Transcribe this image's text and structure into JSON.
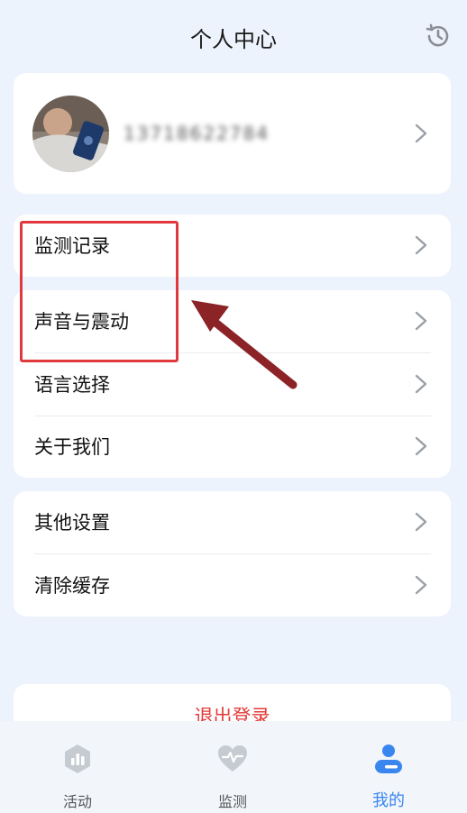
{
  "header": {
    "title": "个人中心",
    "history_icon": "history-icon"
  },
  "profile": {
    "phone": "13718622784",
    "avatar_icon": "avatar"
  },
  "menu_group_1": [
    {
      "label": "监测记录"
    }
  ],
  "menu_group_2": [
    {
      "label": "声音与震动"
    },
    {
      "label": "语言选择"
    },
    {
      "label": "关于我们"
    }
  ],
  "menu_group_3": [
    {
      "label": "其他设置"
    },
    {
      "label": "清除缓存"
    }
  ],
  "logout": {
    "label": "退出登录"
  },
  "tabbar": {
    "items": [
      {
        "label": "活动",
        "icon": "activity-icon",
        "active": false
      },
      {
        "label": "监测",
        "icon": "heart-monitor-icon",
        "active": false
      },
      {
        "label": "我的",
        "icon": "profile-icon",
        "active": true
      }
    ]
  },
  "colors": {
    "accent": "#3a86ef",
    "logout_red": "#e33a3a",
    "highlight_red": "#e0383c",
    "arrow": "#8b2327"
  }
}
